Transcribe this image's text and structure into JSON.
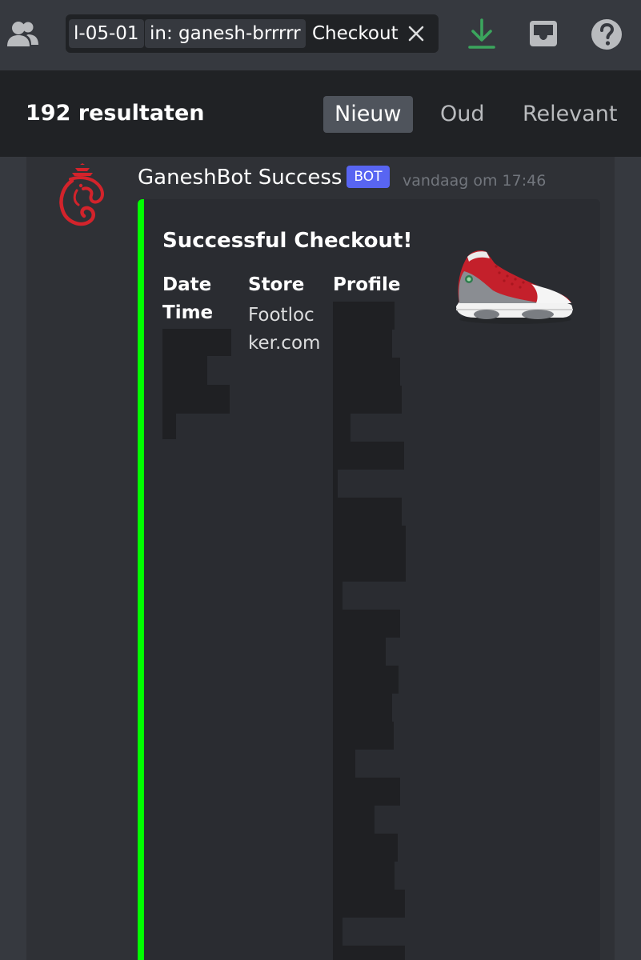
{
  "search": {
    "token_date": "l-05-01",
    "token_channel": "in: ganesh-brrrrr",
    "query": "Checkout"
  },
  "icons": {
    "members": "members-icon",
    "clear": "close-icon",
    "download": "download-icon",
    "inbox": "inbox-icon",
    "help": "help-icon"
  },
  "results": {
    "count_label": "192 resultaten",
    "sort_tabs": [
      "Nieuw",
      "Oud",
      "Relevant"
    ],
    "active_tab": "Nieuw"
  },
  "message": {
    "author": "GaneshBot Success",
    "badge": "BOT",
    "timestamp": "vandaag om 17:46",
    "embed": {
      "title": "Successful Checkout!",
      "fields": [
        {
          "name": "Date Time",
          "value": ""
        },
        {
          "name": "Store",
          "value": "Footlocker.com"
        },
        {
          "name": "Profile",
          "value": ""
        }
      ]
    }
  },
  "colors": {
    "embed_accent": "#00ff00",
    "download_icon": "#3ba55d",
    "badge": "#5865f2",
    "avatar": "#d3232b"
  }
}
